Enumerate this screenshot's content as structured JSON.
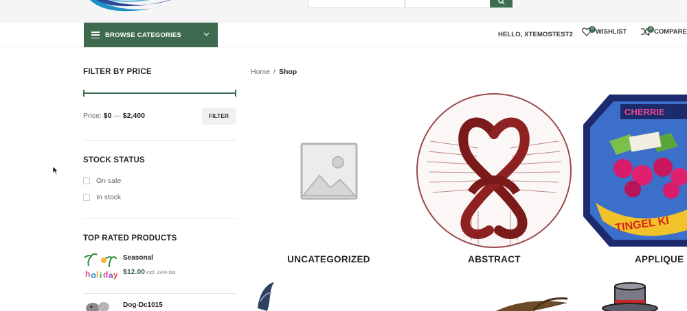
{
  "header": {
    "logo": "store-logo",
    "search_icon": "search-icon"
  },
  "nav": {
    "browse_label": "BROWSE CATEGORIES",
    "greeting": "HELLO, XTEMOSTEST2",
    "wishlist_label": "WISHLIST",
    "wishlist_count": "0",
    "compare_label": "COMPARE",
    "compare_count": "0"
  },
  "sidebar": {
    "price_filter": {
      "title": "FILTER BY PRICE",
      "price_prefix": "Price:",
      "min": "$0",
      "dash": "—",
      "max": "$2,400",
      "button": "FILTER"
    },
    "stock": {
      "title": "STOCK STATUS",
      "options": [
        "On sale",
        "In stock"
      ]
    },
    "top_rated": {
      "title": "TOP RATED PRODUCTS",
      "products": [
        {
          "name": "Seasonal",
          "price": "$12.00",
          "tax_note": "incl. 24% tax"
        },
        {
          "name": "Dog-Dc1015",
          "price": "",
          "tax_note": ""
        }
      ]
    }
  },
  "breadcrumb": {
    "home": "Home",
    "separator": "/",
    "current": "Shop"
  },
  "categories": [
    {
      "label": "UNCATEGORIZED"
    },
    {
      "label": "ABSTRACT"
    },
    {
      "label": "APPLIQUE"
    }
  ],
  "colors": {
    "brand_green": "#3e6a50",
    "header_bg": "#f5f5f5",
    "text_dark": "#242424"
  }
}
